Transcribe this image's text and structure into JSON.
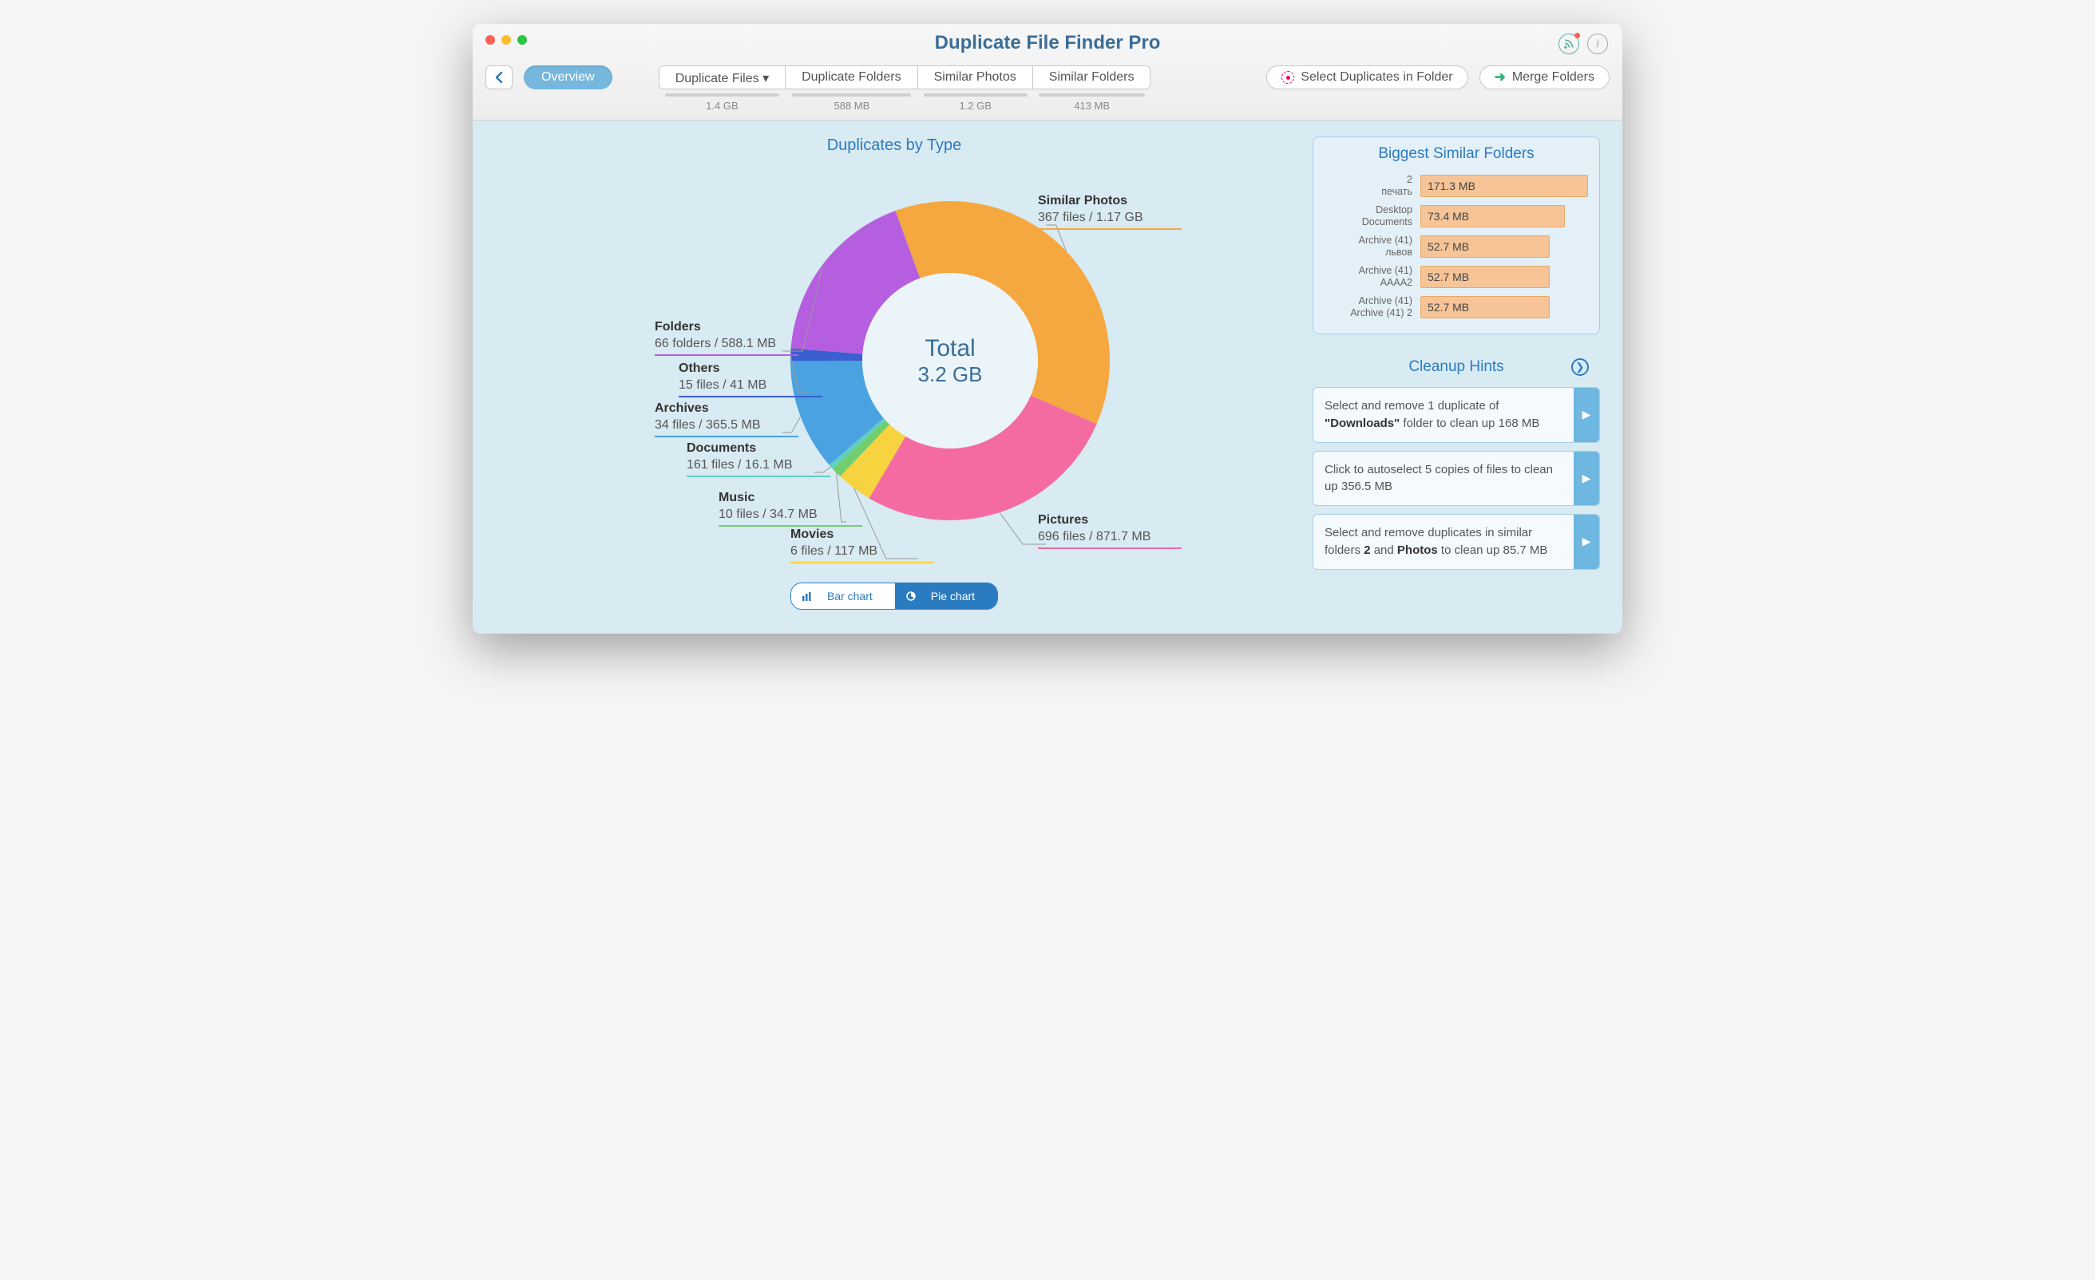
{
  "app_title": "Duplicate File Finder Pro",
  "toolbar": {
    "overview": "Overview",
    "tabs": [
      {
        "label": "Duplicate Files ▾",
        "size": "1.4 GB"
      },
      {
        "label": "Duplicate Folders",
        "size": "588 MB"
      },
      {
        "label": "Similar Photos",
        "size": "1.2 GB"
      },
      {
        "label": "Similar Folders",
        "size": "413 MB"
      }
    ],
    "select_duplicates": "Select Duplicates in Folder",
    "merge_folders": "Merge Folders"
  },
  "chart_title": "Duplicates by Type",
  "total_label": "Total",
  "total_value": "3.2 GB",
  "toggle": {
    "bar": "Bar chart",
    "pie": "Pie chart"
  },
  "chart_data": {
    "type": "pie",
    "title": "Duplicates by Type",
    "center_label": "Total",
    "center_value": "3.2 GB",
    "series": [
      {
        "name": "Similar Photos",
        "files": 367,
        "unit": "files",
        "size_label": "1.17 GB",
        "size_mb": 1198,
        "color": "#f5a740"
      },
      {
        "name": "Pictures",
        "files": 696,
        "unit": "files",
        "size_label": "871.7 MB",
        "size_mb": 871.7,
        "color": "#f46ba1"
      },
      {
        "name": "Movies",
        "files": 6,
        "unit": "files",
        "size_label": "117 MB",
        "size_mb": 117,
        "color": "#f7d33f"
      },
      {
        "name": "Music",
        "files": 10,
        "unit": "files",
        "size_label": "34.7 MB",
        "size_mb": 34.7,
        "color": "#6fcf6f"
      },
      {
        "name": "Documents",
        "files": 161,
        "unit": "files",
        "size_label": "16.1 MB",
        "size_mb": 16.1,
        "color": "#5fcfc0"
      },
      {
        "name": "Archives",
        "files": 34,
        "unit": "files",
        "size_label": "365.5 MB",
        "size_mb": 365.5,
        "color": "#4aa3e0"
      },
      {
        "name": "Others",
        "files": 15,
        "unit": "files",
        "size_label": "41 MB",
        "size_mb": 41,
        "color": "#3a5fcf"
      },
      {
        "name": "Folders",
        "files": 66,
        "unit": "folders",
        "size_label": "588.1 MB",
        "size_mb": 588.1,
        "color": "#b65ee0"
      }
    ]
  },
  "biggest_similar": {
    "title": "Biggest Similar Folders",
    "items": [
      {
        "line1": "2",
        "line2": "печать",
        "size": "171.3 MB",
        "width": 100
      },
      {
        "line1": "Desktop",
        "line2": "Documents",
        "size": "73.4 MB",
        "width": 86
      },
      {
        "line1": "Archive (41)",
        "line2": "львов",
        "size": "52.7 MB",
        "width": 77
      },
      {
        "line1": "Archive (41)",
        "line2": "AAAA2",
        "size": "52.7 MB",
        "width": 77
      },
      {
        "line1": "Archive (41)",
        "line2": "Archive (41) 2",
        "size": "52.7 MB",
        "width": 77
      }
    ]
  },
  "cleanup": {
    "title": "Cleanup Hints",
    "hints": [
      {
        "html": "Select and remove 1 duplicate of <b>\"Downloads\"</b> folder to clean up 168 MB"
      },
      {
        "html": "Click to autoselect 5 copies of files to clean up 356.5 MB"
      },
      {
        "html": "Select and remove duplicates in similar folders <b>2</b> and <b>Photos</b> to clean up 85.7 MB"
      }
    ]
  }
}
